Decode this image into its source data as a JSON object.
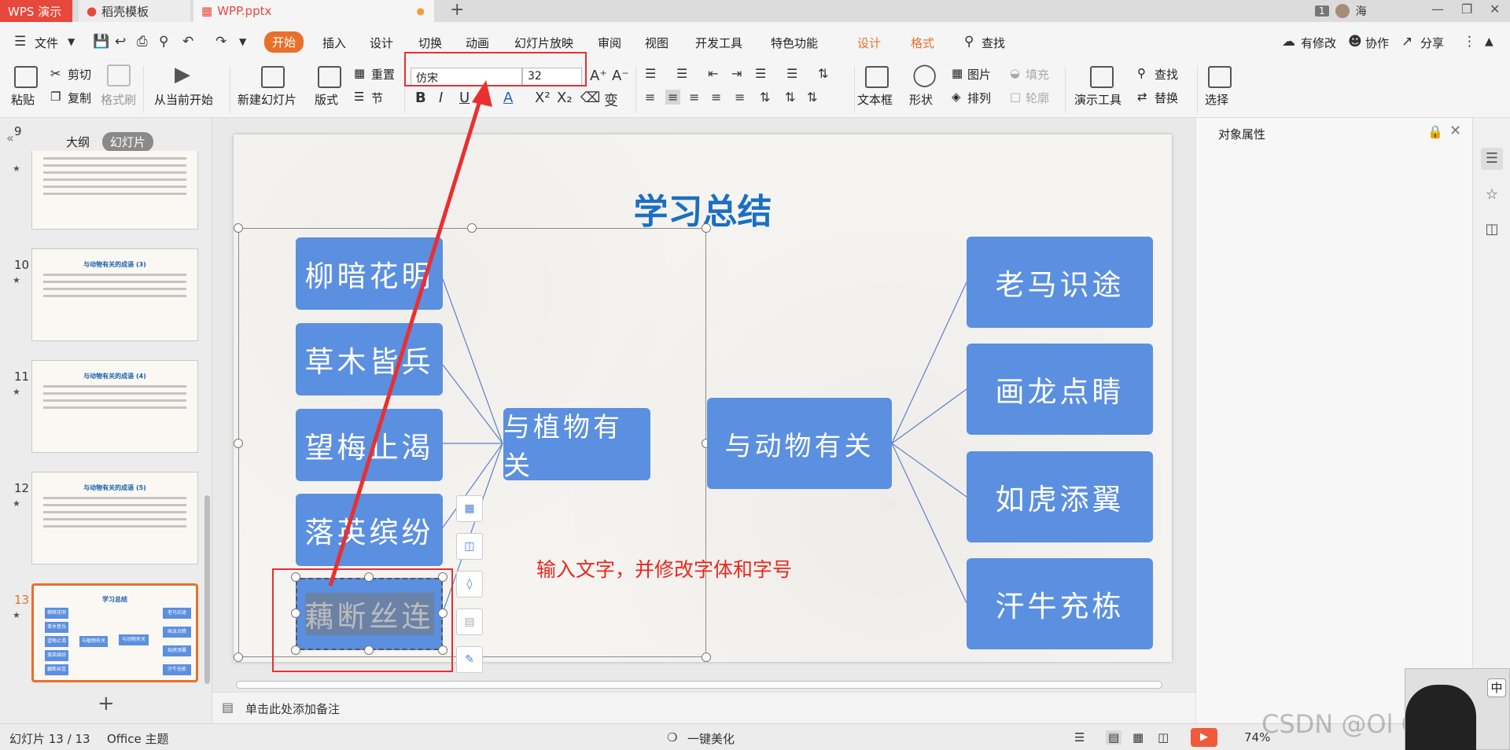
{
  "titlebar": {
    "tabs": [
      {
        "label": "WPS 演示"
      },
      {
        "label": "稻壳模板"
      },
      {
        "label": "WPP.pptx"
      }
    ],
    "new_tab": "+",
    "page_badge": "1",
    "user_label": "海"
  },
  "menubar": {
    "items": [
      "文件",
      "开始",
      "插入",
      "设计",
      "切换",
      "动画",
      "幻灯片放映",
      "审阅",
      "视图",
      "开发工具",
      "特色功能",
      "设计",
      "格式",
      "查找"
    ],
    "right": [
      "有修改",
      "协作",
      "分享"
    ]
  },
  "ribbon": {
    "paste": "粘贴",
    "cut": "剪切",
    "copy": "复制",
    "format_painter": "格式刷",
    "from_current": "从当前开始",
    "new_slide": "新建幻灯片",
    "layout": "版式",
    "reset": "重置",
    "section": "节",
    "font_name": "仿宋",
    "font_size": "32",
    "textbox": "文本框",
    "shape": "形状",
    "picture": "图片",
    "fill": "填充",
    "arrange": "排列",
    "outline": "轮廓",
    "present_tools": "演示工具",
    "find": "查找",
    "replace": "替换",
    "select": "选择"
  },
  "left_panel": {
    "tab_outline": "大纲",
    "tab_slides": "幻灯片",
    "slides": [
      {
        "num": "9",
        "title": ""
      },
      {
        "num": "10",
        "title": "与动物有关的成语 (3)"
      },
      {
        "num": "11",
        "title": "与动物有关的成语 (4)"
      },
      {
        "num": "12",
        "title": "与动物有关的成语 (5)"
      },
      {
        "num": "13",
        "title": "学习总结"
      }
    ],
    "thumb13": {
      "left": [
        "柳暗花明",
        "草木皆兵",
        "望梅止渴",
        "落英缤纷",
        "藕断丝连"
      ],
      "center_left": "与植物有关",
      "center_right": "与动物有关",
      "right": [
        "老马识途",
        "画龙点睛",
        "如虎添翼",
        "汗牛充栋"
      ]
    },
    "add_button": "+"
  },
  "slide": {
    "title": "学习总结",
    "left_nodes": [
      "柳暗花明",
      "草木皆兵",
      "望梅止渴",
      "落英缤纷",
      "藕断丝连"
    ],
    "center_left": "与植物有关",
    "center_right": "与动物有关",
    "right_nodes": [
      "老马识途",
      "画龙点睛",
      "如虎添翼",
      "汗牛充栋"
    ],
    "annotation": "输入文字，并修改字体和字号",
    "annotation_color": "#e8281e",
    "node_color": "#5b8fe0",
    "title_color": "#1a6fc2"
  },
  "right_panel": {
    "title": "对象属性"
  },
  "notes": {
    "placeholder": "单击此处添加备注"
  },
  "statusbar": {
    "slide_counter": "幻灯片 13 / 13",
    "theme": "Office 主题",
    "beautify": "一键美化",
    "zoom": "74%"
  },
  "watermark": "CSDN @Ol Correct",
  "ime": "中",
  "accent_color": "#e8702a",
  "wps_red": "#e8473b"
}
